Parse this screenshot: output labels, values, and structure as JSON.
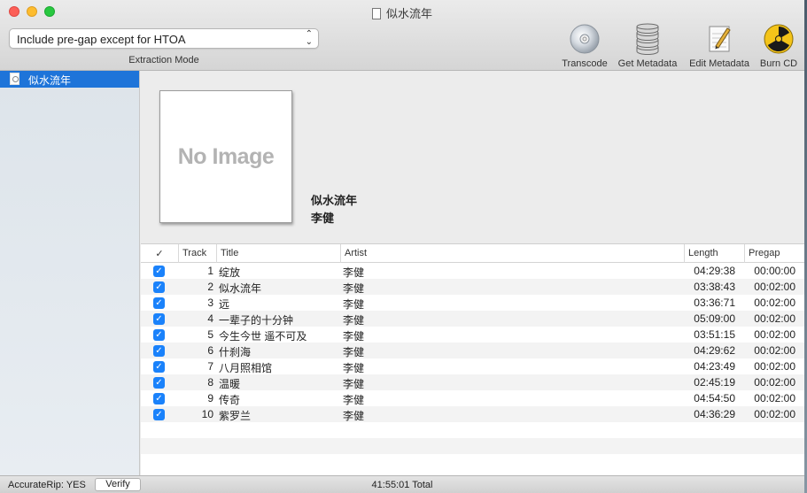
{
  "window": {
    "title": "似水流年"
  },
  "toolbar": {
    "extraction_mode_value": "Include pre-gap except for HTOA",
    "extraction_mode_label": "Extraction Mode",
    "transcode": "Transcode",
    "get_metadata": "Get Metadata",
    "edit_metadata": "Edit Metadata",
    "burn_cd": "Burn CD"
  },
  "sidebar": {
    "items": [
      {
        "label": "似水流年"
      }
    ]
  },
  "album": {
    "cover_placeholder": "No Image",
    "title": "似水流年",
    "artist": "李健"
  },
  "table": {
    "headers": {
      "check": "✓",
      "track": "Track",
      "title": "Title",
      "artist": "Artist",
      "length": "Length",
      "pregap": "Pregap"
    },
    "rows": [
      {
        "track": "1",
        "title": "绽放",
        "artist": "李健",
        "length": "04:29:38",
        "pregap": "00:00:00"
      },
      {
        "track": "2",
        "title": "似水流年",
        "artist": "李健",
        "length": "03:38:43",
        "pregap": "00:02:00"
      },
      {
        "track": "3",
        "title": "远",
        "artist": "李健",
        "length": "03:36:71",
        "pregap": "00:02:00"
      },
      {
        "track": "4",
        "title": "一辈子的十分钟",
        "artist": "李健",
        "length": "05:09:00",
        "pregap": "00:02:00"
      },
      {
        "track": "5",
        "title": "今生今世 遥不可及",
        "artist": "李健",
        "length": "03:51:15",
        "pregap": "00:02:00"
      },
      {
        "track": "6",
        "title": "什刹海",
        "artist": "李健",
        "length": "04:29:62",
        "pregap": "00:02:00"
      },
      {
        "track": "7",
        "title": "八月照相馆",
        "artist": "李健",
        "length": "04:23:49",
        "pregap": "00:02:00"
      },
      {
        "track": "8",
        "title": "温暖",
        "artist": "李健",
        "length": "02:45:19",
        "pregap": "00:02:00"
      },
      {
        "track": "9",
        "title": "传奇",
        "artist": "李健",
        "length": "04:54:50",
        "pregap": "00:02:00"
      },
      {
        "track": "10",
        "title": "紫罗兰",
        "artist": "李健",
        "length": "04:36:29",
        "pregap": "00:02:00"
      }
    ]
  },
  "status": {
    "accuraterip": "AccurateRip: YES",
    "verify": "Verify",
    "total": "41:55:01 Total"
  },
  "colors": {
    "selection": "#1e74d9",
    "checkbox": "#1a82fb"
  }
}
